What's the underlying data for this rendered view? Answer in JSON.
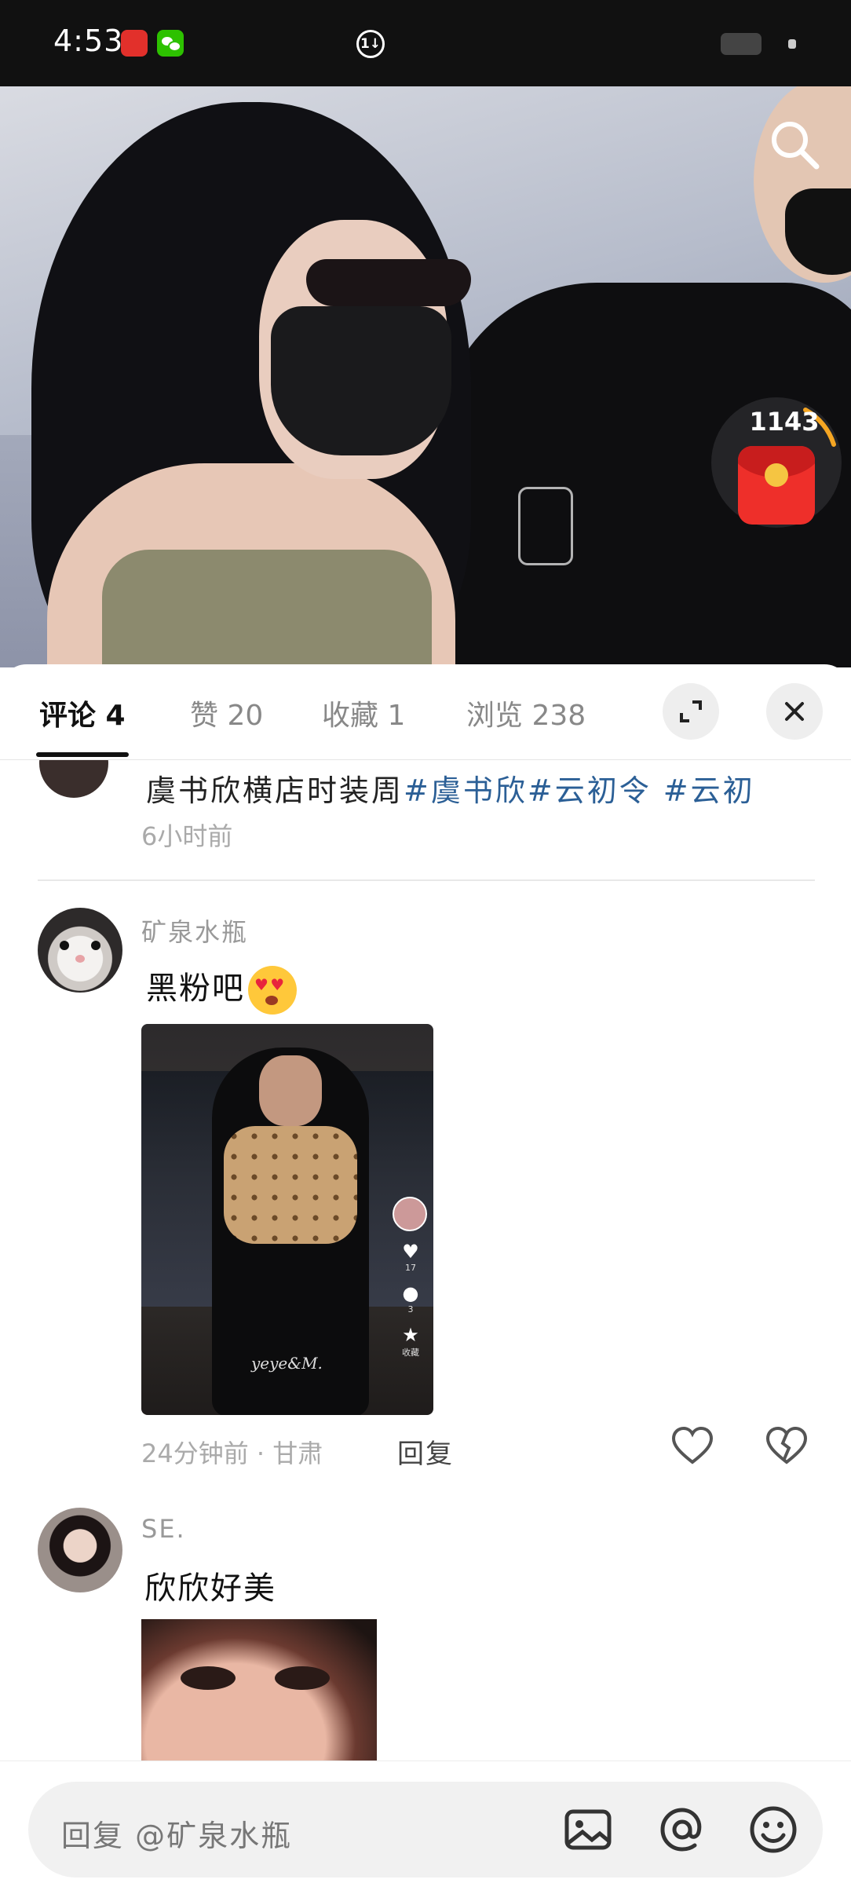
{
  "status_bar": {
    "time": "4:53",
    "sync_badge": "1↓"
  },
  "hero": {
    "coin_count": "1143"
  },
  "tabs": [
    {
      "label": "评论 4"
    },
    {
      "label": "赞 20"
    },
    {
      "label": "收藏 1"
    },
    {
      "label": "浏览 238"
    }
  ],
  "post": {
    "text": "虞书欣横店时装周",
    "tags": [
      "#虞书欣",
      "#云初令",
      " #云初"
    ],
    "time": "6小时前"
  },
  "comments": [
    {
      "username": "矿泉水瓶",
      "text": "黑粉吧",
      "emoji": "heart-eyes-emoji",
      "meta": "24分钟前 · 甘肃",
      "reply_label": "回复",
      "video": {
        "like_count": "17",
        "comment_count": "3",
        "fav_label": "收藏",
        "signature": "yeye&M."
      }
    },
    {
      "username": "SE.",
      "text": "欣欣好美"
    }
  ],
  "reply_bar": {
    "placeholder": "回复 @矿泉水瓶"
  },
  "icons": {
    "search": "search-icon",
    "expand": "expand-icon",
    "close": "close-icon",
    "like": "heart-outline-icon",
    "dislike": "broken-heart-icon",
    "image": "image-icon",
    "mention": "at-icon",
    "emoji": "smiley-icon"
  },
  "colors": {
    "tag": "#2b5f96",
    "red_envelope": "#ee2f2a",
    "muted": "#999999"
  }
}
